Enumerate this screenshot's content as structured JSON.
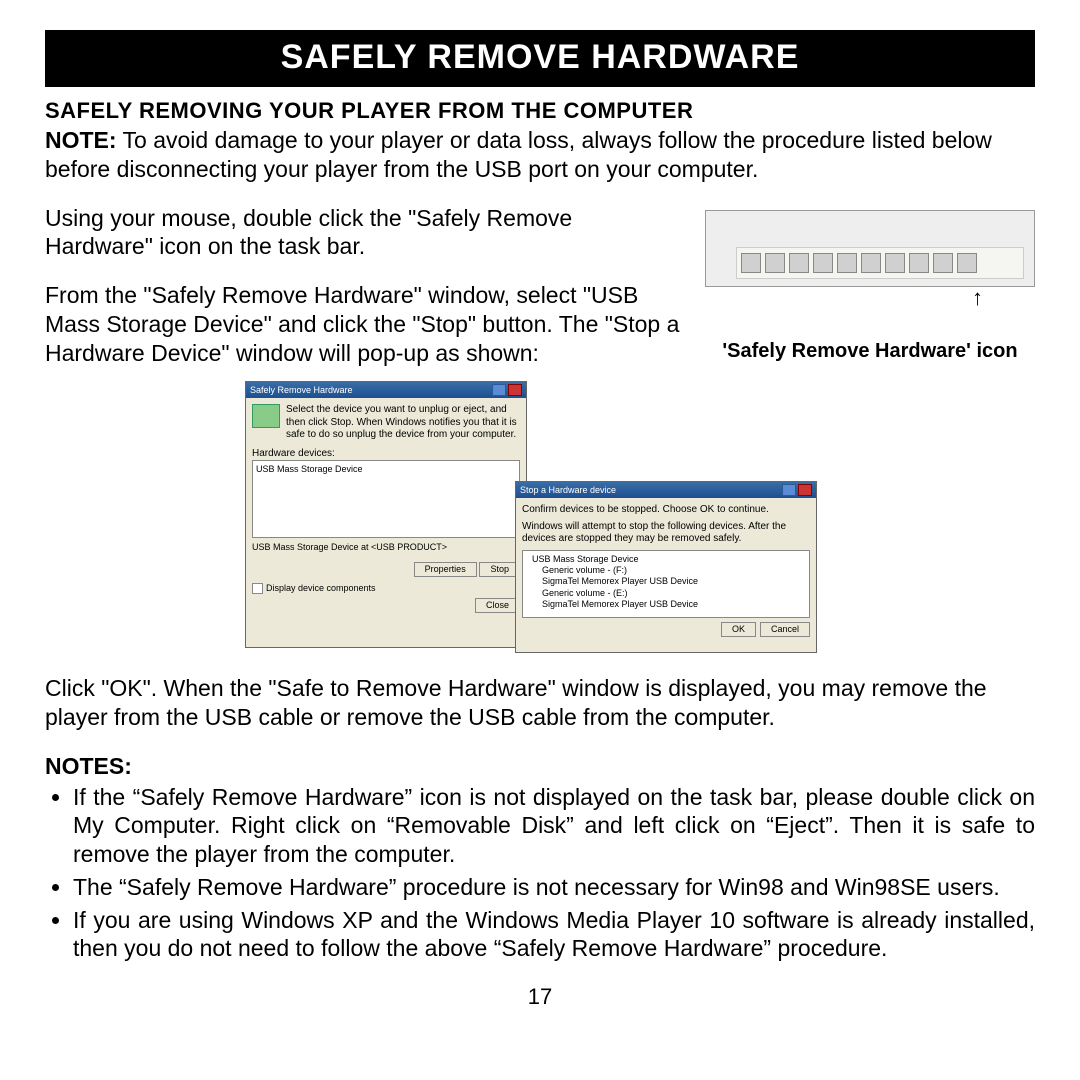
{
  "title": "SAFELY REMOVE HARDWARE",
  "subheading": "SAFELY REMOVING YOUR PLAYER FROM THE COMPUTER",
  "note_label": "NOTE:",
  "note_text": " To avoid damage to your player or data loss, always follow the procedure listed below before disconnecting your player from the USB port on your computer.",
  "para1": "Using your mouse, double click the \"Safely Remove Hardware\" icon on the task bar.",
  "para2": "From the \"Safely Remove Hardware\" window, select \"USB Mass Storage Device\" and click the \"Stop\" button. The \"Stop a Hardware Device\" window will pop-up as shown:",
  "taskbar_caption": "'Safely Remove Hardware' icon",
  "dialog1": {
    "title": "Safely Remove Hardware",
    "desc": "Select the device you want to unplug or eject, and then click Stop. When Windows notifies you that it is safe to do so unplug the device from your computer.",
    "label": "Hardware devices:",
    "item": "USB Mass Storage Device",
    "status": "USB Mass Storage Device at <USB PRODUCT>",
    "props": "Properties",
    "stop": "Stop",
    "check": "Display device components",
    "close": "Close"
  },
  "dialog2": {
    "title": "Stop a Hardware device",
    "line1": "Confirm devices to be stopped. Choose OK to continue.",
    "line2": "Windows will attempt to stop the following devices. After the devices are stopped they may be removed safely.",
    "items": [
      "USB Mass Storage Device",
      "Generic volume - (F:)",
      "SigmaTel Memorex Player USB Device",
      "Generic volume - (E:)",
      "SigmaTel Memorex Player USB Device"
    ],
    "ok": "OK",
    "cancel": "Cancel"
  },
  "para3": "Click \"OK\". When the \"Safe to Remove Hardware\" window is displayed, you may remove the player from the USB cable or remove the USB cable from the computer.",
  "notes_head": "NOTES:",
  "notes": [
    "If the “Safely Remove Hardware” icon is not displayed on the task bar, please double click on My Computer.  Right click on “Removable Disk” and left click on “Eject”.  Then it is safe to remove the player from the computer.",
    "The “Safely Remove Hardware” procedure is not necessary for Win98 and Win98SE users.",
    "If you are using Windows XP and the Windows Media Player 10 software is already installed, then you do not need to follow the above “Safely Remove Hardware” procedure."
  ],
  "page_number": "17"
}
